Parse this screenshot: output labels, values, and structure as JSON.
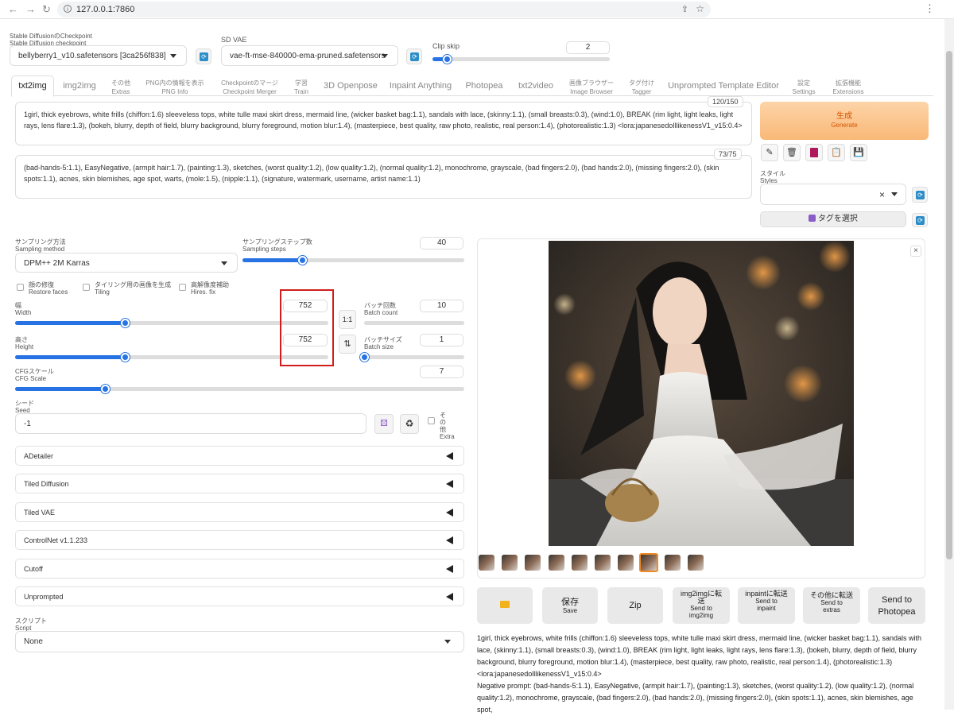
{
  "browser": {
    "url": "127.0.0.1:7860"
  },
  "model": {
    "checkpoint_label_ja": "Stable DiffusionのCheckpoint",
    "checkpoint_label_en": "Stable Diffusion checkpoint",
    "checkpoint_value": "bellyberry1_v10.safetensors [3ca256f838]",
    "vae_label": "SD VAE",
    "vae_value": "vae-ft-mse-840000-ema-pruned.safetensors",
    "clip_label": "Clip skip",
    "clip_value": "2",
    "clip_level": 0.08
  },
  "tabs": [
    {
      "ja": "txt2img",
      "en": ""
    },
    {
      "ja": "img2img",
      "en": ""
    },
    {
      "ja": "その他",
      "en": "Extras"
    },
    {
      "ja": "PNG内の情報を表示",
      "en": "PNG Info"
    },
    {
      "ja": "Checkpointのマージ",
      "en": "Checkpoint Merger"
    },
    {
      "ja": "学習",
      "en": "Train"
    },
    {
      "ja": "3D Openpose",
      "en": ""
    },
    {
      "ja": "Inpaint Anything",
      "en": ""
    },
    {
      "ja": "Photopea",
      "en": ""
    },
    {
      "ja": "txt2video",
      "en": ""
    },
    {
      "ja": "画像ブラウザー",
      "en": "Image Browser"
    },
    {
      "ja": "タグ付け",
      "en": "Tagger"
    },
    {
      "ja": "Unprompted Template Editor",
      "en": ""
    },
    {
      "ja": "設定",
      "en": "Settings"
    },
    {
      "ja": "拡張機能",
      "en": "Extensions"
    }
  ],
  "prompt": {
    "text": "1girl, thick eyebrows, white frills (chiffon:1.6) sleeveless tops, white tulle maxi skirt dress, mermaid line, (wicker basket bag:1.1), sandals with lace, (skinny:1.1), (small breasts:0.3), (wind:1.0), BREAK (rim light, light leaks, light rays, lens flare:1.3), (bokeh, blurry, depth of field, blurry background, blurry foreground, motion blur:1.4), (masterpiece, best quality, raw photo, realistic, real person:1.4), (photorealistic:1.3) <lora:japanesedolllikenessV1_v15:0.4>",
    "counter": "120/150"
  },
  "negative": {
    "text": "(bad-hands-5:1.1), EasyNegative, (armpit hair:1.7), (painting:1.3), sketches, (worst quality:1.2), (low quality:1.2), (normal quality:1.2), monochrome, grayscale, (bad fingers:2.0), (bad hands:2.0), (missing fingers:2.0), (skin spots:1.1), acnes, skin blemishes, age spot, warts, (mole:1.5), (nipple:1.1), (signature, watermark, username, artist name:1.1)",
    "counter": "73/75"
  },
  "generate": {
    "ja": "生成",
    "en": "Generate"
  },
  "styles": {
    "ja": "スタイル",
    "en": "Styles",
    "clear": "×"
  },
  "tag_select": "タグを選択",
  "sampling": {
    "method_ja": "サンプリング方法",
    "method_en": "Sampling method",
    "method_value": "DPM++ 2M Karras",
    "steps_ja": "サンプリングステップ数",
    "steps_en": "Sampling steps",
    "steps_value": "40",
    "steps_level": 0.27
  },
  "checks": [
    {
      "ja": "顔の修復",
      "en": "Restore faces"
    },
    {
      "ja": "タイリング用の画像を生成",
      "en": "Tiling"
    },
    {
      "ja": "高解像度補助",
      "en": "Hires. fix"
    }
  ],
  "size": {
    "width_ja": "幅",
    "width_en": "Width",
    "width_value": "752",
    "width_level": 0.35,
    "height_ja": "高さ",
    "height_en": "Height",
    "height_value": "752",
    "height_level": 0.35,
    "ratio": "1:1",
    "swap": "⇅"
  },
  "batch": {
    "count_ja": "バッチ回数",
    "count_en": "Batch count",
    "count_value": "10",
    "count_level": 1.0,
    "size_ja": "バッチサイズ",
    "size_en": "Batch size",
    "size_value": "1",
    "size_level": 0.0
  },
  "cfg": {
    "ja": "CFGスケール",
    "en": "CFG Scale",
    "value": "7",
    "level": 0.2
  },
  "seed": {
    "ja": "シード",
    "en": "Seed",
    "value": "-1",
    "extra_ja": "その他",
    "extra_en": "Extra"
  },
  "accordions": [
    "ADetailer",
    "Tiled Diffusion",
    "Tiled VAE",
    "ControlNet v1.1.233",
    "Cutoff",
    "Unprompted"
  ],
  "script": {
    "ja": "スクリプト",
    "en": "Script",
    "value": "None"
  },
  "output": {
    "close": "×",
    "thumbnail_count": 10,
    "selected_thumbnail": 8
  },
  "actions": [
    {
      "top": "",
      "big": "",
      "bottom": ""
    },
    {
      "top": "",
      "big": "保存",
      "bottom": "Save"
    },
    {
      "top": "",
      "big": "Zip",
      "bottom": ""
    },
    {
      "top": "img2imgに転送",
      "big": "",
      "bottom": "Send to img2img"
    },
    {
      "top": "inpaintに転送",
      "big": "",
      "bottom": "Send to inpaint"
    },
    {
      "top": "その他に転送",
      "big": "",
      "bottom": "Send to extras"
    },
    {
      "top": "",
      "big": "Send to Photopea",
      "bottom": ""
    }
  ],
  "info": {
    "prompt_line": "1girl, thick eyebrows, white frills (chiffon:1.6) sleeveless tops, white tulle maxi skirt dress, mermaid line, (wicker basket bag:1.1), sandals with lace, (skinny:1.1), (small breasts:0.3), (wind:1.0), BREAK (rim light, light leaks, light rays, lens flare:1.3), (bokeh, blurry, depth of field, blurry background, blurry foreground, motion blur:1.4), (masterpiece, best quality, raw photo, realistic, real person:1.4), (photorealistic:1.3) <lora:japanesedolllikenessV1_v15:0.4>",
    "negative_line": "Negative prompt: (bad-hands-5:1.1), EasyNegative, (armpit hair:1.7), (painting:1.3), sketches, (worst quality:1.2), (low quality:1.2), (normal quality:1.2), monochrome, grayscale, (bad fingers:2.0), (bad hands:2.0), (missing fingers:2.0), (skin spots:1.1), acnes, skin blemishes, age spot,"
  },
  "colors": {
    "accent": "#2773e3",
    "generate": "#f9b877",
    "highlight": "#d21d1d"
  }
}
